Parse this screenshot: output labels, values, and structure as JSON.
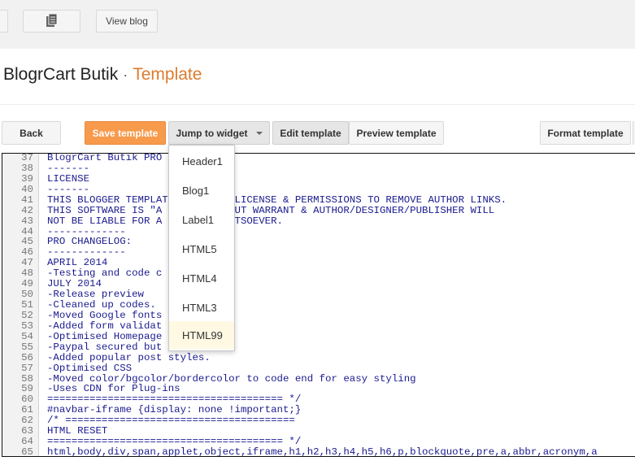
{
  "topbar": {
    "view_blog_label": "View blog"
  },
  "header": {
    "blog_name": "BlogrCart Butik",
    "separator": "·",
    "section": "Template"
  },
  "toolbar": {
    "back_label": "Back",
    "save_label": "Save template",
    "jump_label": "Jump to widget",
    "edit_label": "Edit template",
    "preview_label": "Preview template",
    "format_label": "Format template"
  },
  "dropdown": {
    "items": [
      {
        "label": "Header1"
      },
      {
        "label": "Blog1"
      },
      {
        "label": "Label1"
      },
      {
        "label": "HTML5"
      },
      {
        "label": "HTML4"
      },
      {
        "label": "HTML3"
      },
      {
        "label": "HTML99"
      }
    ],
    "highlighted": "HTML99"
  },
  "editor": {
    "lines": [
      {
        "n": "37",
        "t": "BlogrCart Butik PRO"
      },
      {
        "n": "38",
        "t": "-------"
      },
      {
        "n": "39",
        "t": "LICENSE"
      },
      {
        "n": "40",
        "t": "-------"
      },
      {
        "n": "41",
        "t": "THIS BLOGGER TEMPLATE          LICENSE & PERMISSIONS TO REMOVE AUTHOR LINKS."
      },
      {
        "n": "42",
        "t": "THIS SOFTWARE IS \"A           OUT WARRANT & AUTHOR/DESIGNER/PUBLISHER WILL"
      },
      {
        "n": "43",
        "t": "NOT BE LIABLE FOR A           ATSOEVER."
      },
      {
        "n": "44",
        "t": "-------------"
      },
      {
        "n": "45",
        "t": "PRO CHANGELOG:"
      },
      {
        "n": "46",
        "t": "-------------"
      },
      {
        "n": "47",
        "t": "APRIL 2014"
      },
      {
        "n": "48",
        "t": "-Testing and code c"
      },
      {
        "n": "49",
        "t": "JULY 2014"
      },
      {
        "n": "50",
        "t": "-Release preview"
      },
      {
        "n": "51",
        "t": "-Cleaned up codes."
      },
      {
        "n": "52",
        "t": "-Moved Google fonts"
      },
      {
        "n": "53",
        "t": "-Added form validat"
      },
      {
        "n": "54",
        "t": "-Optimised Homepage"
      },
      {
        "n": "55",
        "t": "-Paypal secured but"
      },
      {
        "n": "56",
        "t": "-Added popular post styles."
      },
      {
        "n": "57",
        "t": "-Optimised CSS"
      },
      {
        "n": "58",
        "t": "-Moved color/bgcolor/bordercolor to code end for easy styling"
      },
      {
        "n": "59",
        "t": "-Uses CDN for Plug-ins"
      },
      {
        "n": "60",
        "t": "======================================= */"
      },
      {
        "n": "61",
        "t": "#navbar-iframe {display: none !important;}"
      },
      {
        "n": "62",
        "t": "/* ======================================"
      },
      {
        "n": "63",
        "t": "HTML RESET"
      },
      {
        "n": "64",
        "t": "======================================= */"
      },
      {
        "n": "65",
        "t": "html,body,div,span,applet,object,iframe,h1,h2,h3,h4,h5,h6,p,blockquote,pre,a,abbr,acronym,a"
      }
    ]
  }
}
